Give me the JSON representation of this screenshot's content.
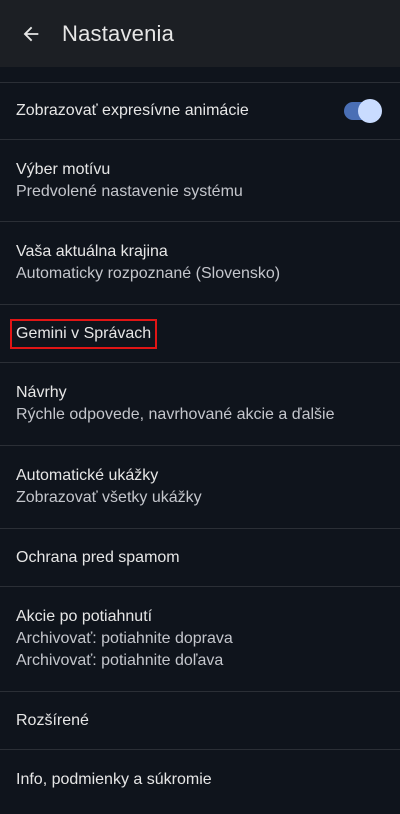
{
  "header": {
    "title": "Nastavenia",
    "back_icon": "arrow-back-icon"
  },
  "settings": {
    "expressive_animations": {
      "label": "Zobrazovať expresívne animácie",
      "enabled": true
    },
    "theme": {
      "label": "Výber motívu",
      "value": "Predvolené nastavenie systému"
    },
    "country": {
      "label": "Vaša aktuálna krajina",
      "value": "Automaticky rozpoznané (Slovensko)"
    },
    "gemini": {
      "label": "Gemini v Správach"
    },
    "suggestions": {
      "label": "Návrhy",
      "value": "Rýchle odpovede, navrhované akcie a ďalšie"
    },
    "previews": {
      "label": "Automatické ukážky",
      "value": "Zobrazovať všetky ukážky"
    },
    "spam": {
      "label": "Ochrana pred spamom"
    },
    "swipe": {
      "label": "Akcie po potiahnutí",
      "value_right": "Archivovať: potiahnite doprava",
      "value_left": "Archivovať: potiahnite doľava"
    },
    "advanced": {
      "label": "Rozšírené"
    },
    "about": {
      "label": "Info, podmienky a súkromie"
    }
  },
  "colors": {
    "background": "#0f141c",
    "appbar": "#1c1f24",
    "toggle_track": "#4a6fb5",
    "toggle_thumb": "#c9dcff",
    "highlight_border": "#e01515"
  }
}
